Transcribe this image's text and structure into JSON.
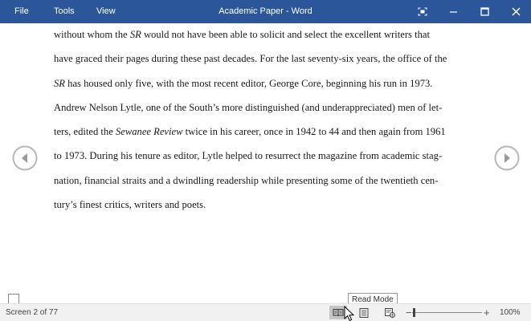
{
  "titlebar": {
    "menu": [
      "File",
      "Tools",
      "View"
    ],
    "title": "Academic Paper - Word",
    "bg_color": "#2b579a"
  },
  "document": {
    "lines": [
      [
        {
          "text": "without whom the ",
          "italic": false
        },
        {
          "text": "SR",
          "italic": true
        },
        {
          "text": " would not have been able to solicit and select the excellent writers that",
          "italic": false
        }
      ],
      [
        {
          "text": "have graced their pages during these past decades. For the last seventy-six years, the office of the",
          "italic": false
        }
      ],
      [
        {
          "text": "SR",
          "italic": true
        },
        {
          "text": " has housed only five, with the most recent editor, George Core, beginning his run in 1973.",
          "italic": false
        }
      ],
      [
        {
          "text": "Andrew Nelson Lytle, one of the South’s more distinguished (and underappreciated) men of let-",
          "italic": false
        }
      ],
      [
        {
          "text": "ters, edited the ",
          "italic": false
        },
        {
          "text": "Sewanee Review",
          "italic": true
        },
        {
          "text": " twice in his career, once in 1942 to 44 and then again from 1961",
          "italic": false
        }
      ],
      [
        {
          "text": "to 1973. During his tenure as editor, Lytle helped to resurrect the magazine from academic stag-",
          "italic": false
        }
      ],
      [
        {
          "text": "nation, financial straits and a dwindling readership while presenting some of the twentieth cen-",
          "italic": false
        }
      ],
      [
        {
          "text": "tury’s finest critics, writers and poets.",
          "italic": false
        }
      ]
    ]
  },
  "tooltip": {
    "text": "Read Mode"
  },
  "statusbar": {
    "screen": "Screen 2 of 77",
    "zoom_label": "100%",
    "zoom_minus": "−",
    "zoom_plus": "+",
    "active_view": "read-mode"
  },
  "icons": {
    "window": [
      "focus-mode-icon",
      "minimize-icon",
      "maximize-icon",
      "close-icon"
    ],
    "nav": [
      "previous-screen-icon",
      "next-screen-icon"
    ],
    "views": [
      "read-mode-icon",
      "print-layout-icon",
      "web-layout-icon"
    ]
  }
}
